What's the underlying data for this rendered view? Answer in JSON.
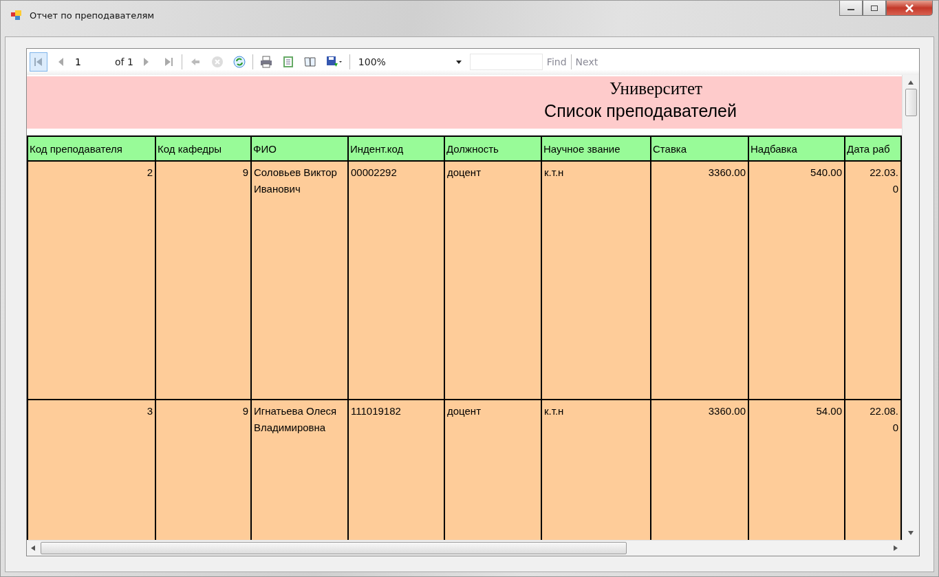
{
  "window": {
    "title": "Отчет по преподавателям"
  },
  "toolbar": {
    "page": "1",
    "page_of": "of 1",
    "zoom": "100%",
    "find_link": {
      "label": "Find",
      "disabled": true
    },
    "next_link": {
      "label": "Next",
      "disabled": true
    }
  },
  "report": {
    "title": "Университет",
    "subtitle": "Список преподавателей",
    "columns": [
      {
        "label": "Код преподавателя",
        "kind": "number"
      },
      {
        "label": "Код кафедры",
        "kind": "number"
      },
      {
        "label": "ФИО",
        "kind": "text"
      },
      {
        "label": "Индент.код",
        "kind": "text"
      },
      {
        "label": "Должность",
        "kind": "text"
      },
      {
        "label": "Научное звание",
        "kind": "text"
      },
      {
        "label": "Ставка",
        "kind": "number"
      },
      {
        "label": "Надбавка",
        "kind": "number"
      },
      {
        "label": "Дата раб",
        "kind": "number"
      }
    ],
    "rows": [
      [
        "2",
        "9",
        "Соловьев Виктор Иванович",
        "00002292",
        "доцент",
        "к.т.н",
        "3360.00",
        "540.00",
        "22.03.\n0"
      ],
      [
        "3",
        "9",
        "Игнатьева Олеся Владимировна",
        "111019182",
        "доцент",
        "к.т.н",
        "3360.00",
        "54.00",
        "22.08.\n0"
      ]
    ]
  }
}
